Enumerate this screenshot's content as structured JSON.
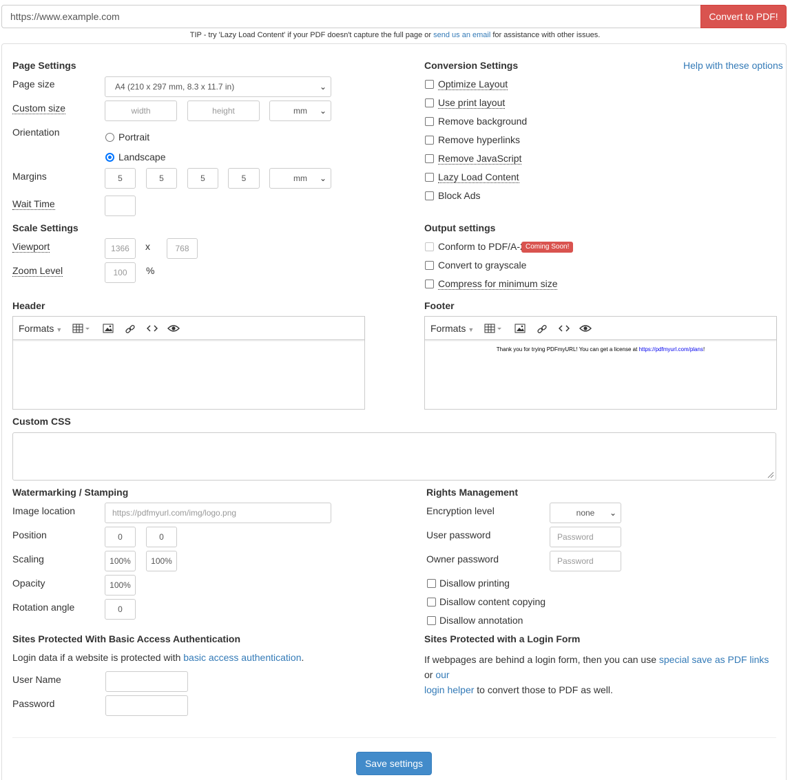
{
  "top": {
    "url_value": "https://www.example.com",
    "convert_label": "Convert to PDF!",
    "tip_prefix": "TIP - try 'Lazy Load Content' if your PDF doesn't capture the full page or ",
    "tip_link": "send us an email",
    "tip_suffix": " for assistance with other issues."
  },
  "page_settings": {
    "heading": "Page Settings",
    "page_size_label": "Page size",
    "page_size_value": "A4 (210 x 297 mm, 8.3 x 11.7 in)",
    "custom_size_label": "Custom size",
    "width_placeholder": "width",
    "height_placeholder": "height",
    "custom_unit": "mm",
    "orientation_label": "Orientation",
    "portrait": "Portrait",
    "landscape": "Landscape",
    "selected_orientation": "Landscape",
    "margins_label": "Margins",
    "margins": [
      "5",
      "5",
      "5",
      "5"
    ],
    "margin_unit": "mm",
    "wait_time_label": "Wait Time",
    "wait_time_value": ""
  },
  "scale_settings": {
    "heading": "Scale Settings",
    "viewport_label": "Viewport",
    "viewport_w": "1366",
    "viewport_x": "x",
    "viewport_h": "768",
    "zoom_label": "Zoom Level",
    "zoom_value": "100",
    "zoom_unit": "%"
  },
  "conversion_settings": {
    "heading": "Conversion Settings",
    "help_link": "Help with these options",
    "options": [
      {
        "label": "Optimize Layout",
        "checked": false,
        "dotted": true
      },
      {
        "label": "Use print layout",
        "checked": false,
        "dotted": true
      },
      {
        "label": "Remove background",
        "checked": false,
        "dotted": false
      },
      {
        "label": "Remove hyperlinks",
        "checked": false,
        "dotted": false
      },
      {
        "label": "Remove JavaScript",
        "checked": false,
        "dotted": true
      },
      {
        "label": "Lazy Load Content",
        "checked": false,
        "dotted": true
      },
      {
        "label": "Block Ads",
        "checked": false,
        "dotted": false
      }
    ]
  },
  "output_settings": {
    "heading": "Output settings",
    "pdfa_label": "Conform to PDF/A-2",
    "pdfa_badge": "Coming Soon!",
    "grayscale_label": "Convert to grayscale",
    "compress_label": "Compress for minimum size"
  },
  "header": {
    "heading": "Header",
    "formats": "Formats",
    "content": ""
  },
  "footer": {
    "heading": "Footer",
    "formats": "Formats",
    "content_prefix": "Thank you for trying PDFmyURL! You can get a license at ",
    "content_link": "https://pdfmyurl.com/plans",
    "content_suffix": "!"
  },
  "custom_css": {
    "heading": "Custom CSS",
    "value": ""
  },
  "watermark": {
    "heading": "Watermarking / Stamping",
    "image_location_label": "Image location",
    "image_location_placeholder": "https://pdfmyurl.com/img/logo.png",
    "position_label": "Position",
    "position_x": "0",
    "position_y": "0",
    "scaling_label": "Scaling",
    "scaling_x": "100%",
    "scaling_y": "100%",
    "opacity_label": "Opacity",
    "opacity_value": "100%",
    "rotation_label": "Rotation angle",
    "rotation_value": "0"
  },
  "rights": {
    "heading": "Rights Management",
    "encryption_label": "Encryption level",
    "encryption_value": "none",
    "user_password_label": "User password",
    "user_password_placeholder": "Password",
    "owner_password_label": "Owner password",
    "owner_password_placeholder": "Password",
    "disallow_printing": "Disallow printing",
    "disallow_copying": "Disallow content copying",
    "disallow_annotation": "Disallow annotation"
  },
  "basic_auth": {
    "heading": "Sites Protected With Basic Access Authentication",
    "desc_prefix": "Login data if a website is protected with ",
    "desc_link": "basic access authentication",
    "desc_suffix": ".",
    "user_name_label": "User Name",
    "password_label": "Password"
  },
  "login_form": {
    "heading": "Sites Protected with a Login Form",
    "line1_prefix": "If webpages are behind a login form, then you can use ",
    "link1": "special save as PDF links",
    "line1_mid": " or ",
    "link2a": "our",
    "link2b": "login helper",
    "line2_suffix": " to convert those to PDF as well."
  },
  "save_label": "Save settings",
  "colors": {
    "convert_bg": "#d9534f",
    "save_bg": "#428bca",
    "link": "#337ab7",
    "badge": "#d9534f"
  }
}
